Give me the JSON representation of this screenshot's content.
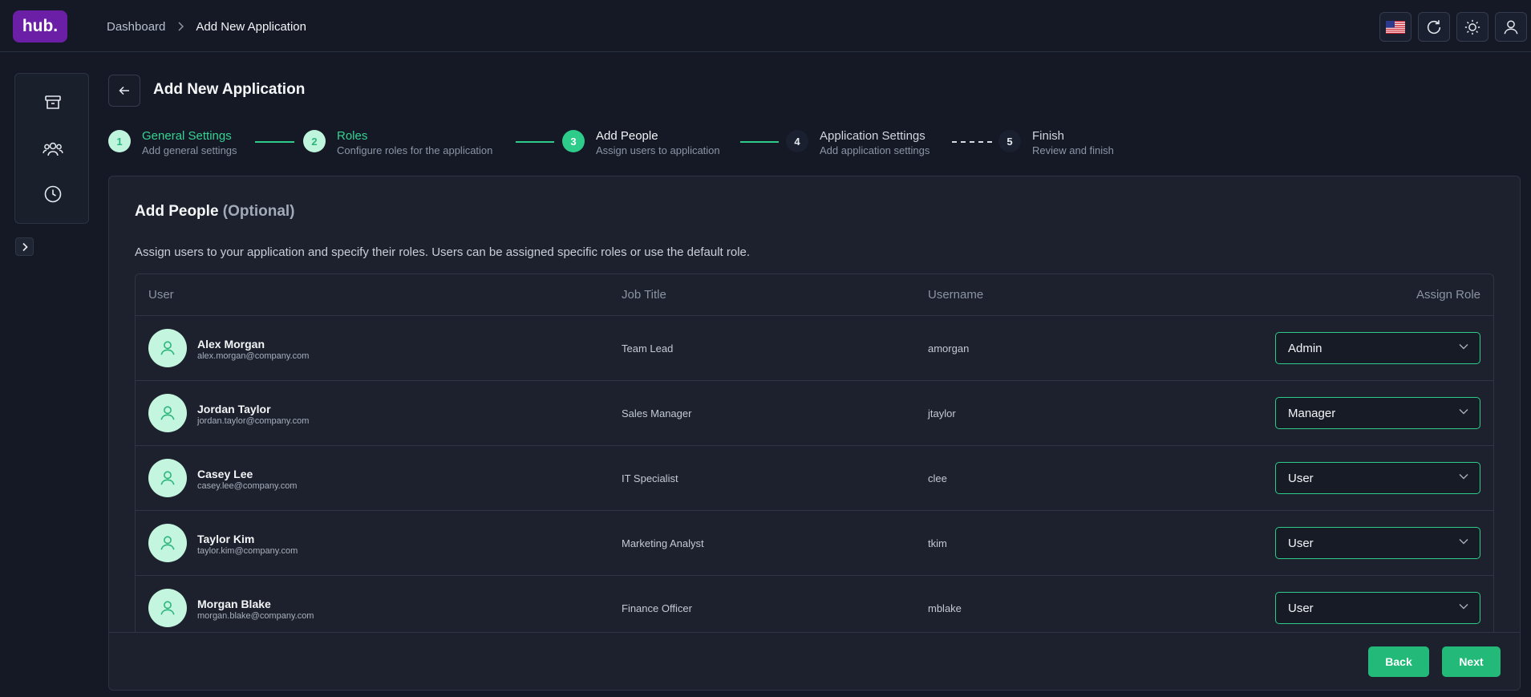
{
  "header": {
    "logo": "hub.",
    "breadcrumb": {
      "root": "Dashboard",
      "current": "Add New Application"
    }
  },
  "page": {
    "title": "Add New Application"
  },
  "stepper": [
    {
      "number": "1",
      "title": "General Settings",
      "subtitle": "Add general settings",
      "state": "done"
    },
    {
      "number": "2",
      "title": "Roles",
      "subtitle": "Configure roles for the application",
      "state": "done"
    },
    {
      "number": "3",
      "title": "Add People",
      "subtitle": "Assign users to application",
      "state": "active"
    },
    {
      "number": "4",
      "title": "Application Settings",
      "subtitle": "Add application settings",
      "state": "todo"
    },
    {
      "number": "5",
      "title": "Finish",
      "subtitle": "Review and finish",
      "state": "todo"
    }
  ],
  "card": {
    "title": "Add People",
    "title_suffix": "(Optional)",
    "description": "Assign users to your application and specify their roles. Users can be assigned specific roles or use the default role."
  },
  "table": {
    "columns": {
      "user": "User",
      "job_title": "Job Title",
      "username": "Username",
      "assign_role": "Assign Role"
    },
    "rows": [
      {
        "name": "Alex Morgan",
        "email": "alex.morgan@company.com",
        "job_title": "Team Lead",
        "username": "amorgan",
        "role": "Admin"
      },
      {
        "name": "Jordan Taylor",
        "email": "jordan.taylor@company.com",
        "job_title": "Sales Manager",
        "username": "jtaylor",
        "role": "Manager"
      },
      {
        "name": "Casey Lee",
        "email": "casey.lee@company.com",
        "job_title": "IT Specialist",
        "username": "clee",
        "role": "User"
      },
      {
        "name": "Taylor Kim",
        "email": "taylor.kim@company.com",
        "job_title": "Marketing Analyst",
        "username": "tkim",
        "role": "User"
      },
      {
        "name": "Morgan Blake",
        "email": "morgan.blake@company.com",
        "job_title": "Finance Officer",
        "username": "mblake",
        "role": "User"
      }
    ]
  },
  "footer": {
    "back": "Back",
    "next": "Next"
  },
  "colors": {
    "accent": "#2ecc8a",
    "brand": "#6b1fa6",
    "background": "#141925",
    "card": "#1c212d"
  },
  "icons": {
    "topbar": [
      "us-flag-icon",
      "refresh-icon",
      "sun-icon",
      "user-icon"
    ],
    "sidebar": [
      "archive-icon",
      "users-icon",
      "clock-icon",
      "chevron-right-icon"
    ]
  }
}
